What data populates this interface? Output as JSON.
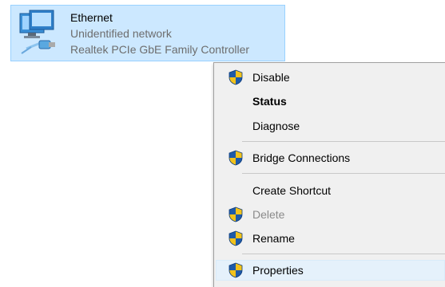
{
  "adapter": {
    "name": "Ethernet",
    "status": "Unidentified network",
    "device": "Realtek PCIe GbE Family Controller",
    "icon": "network-adapter-icon"
  },
  "context_menu": {
    "items": [
      {
        "label": "Disable",
        "shield": true,
        "bold": false,
        "disabled": false
      },
      {
        "label": "Status",
        "shield": false,
        "bold": true,
        "disabled": false
      },
      {
        "label": "Diagnose",
        "shield": false,
        "bold": false,
        "disabled": false
      },
      {
        "label": "Bridge Connections",
        "shield": true,
        "bold": false,
        "disabled": false
      },
      {
        "label": "Create Shortcut",
        "shield": false,
        "bold": false,
        "disabled": false
      },
      {
        "label": "Delete",
        "shield": true,
        "bold": false,
        "disabled": true
      },
      {
        "label": "Rename",
        "shield": true,
        "bold": false,
        "disabled": false
      },
      {
        "label": "Properties",
        "shield": true,
        "bold": false,
        "disabled": false,
        "highlighted": true
      }
    ]
  },
  "colors": {
    "selection_bg": "#cce8ff",
    "menu_bg": "#f0f0f0",
    "hover_bg": "#e5f1fb",
    "shield_blue": "#1e5aa8",
    "shield_yellow": "#f2c21b"
  }
}
